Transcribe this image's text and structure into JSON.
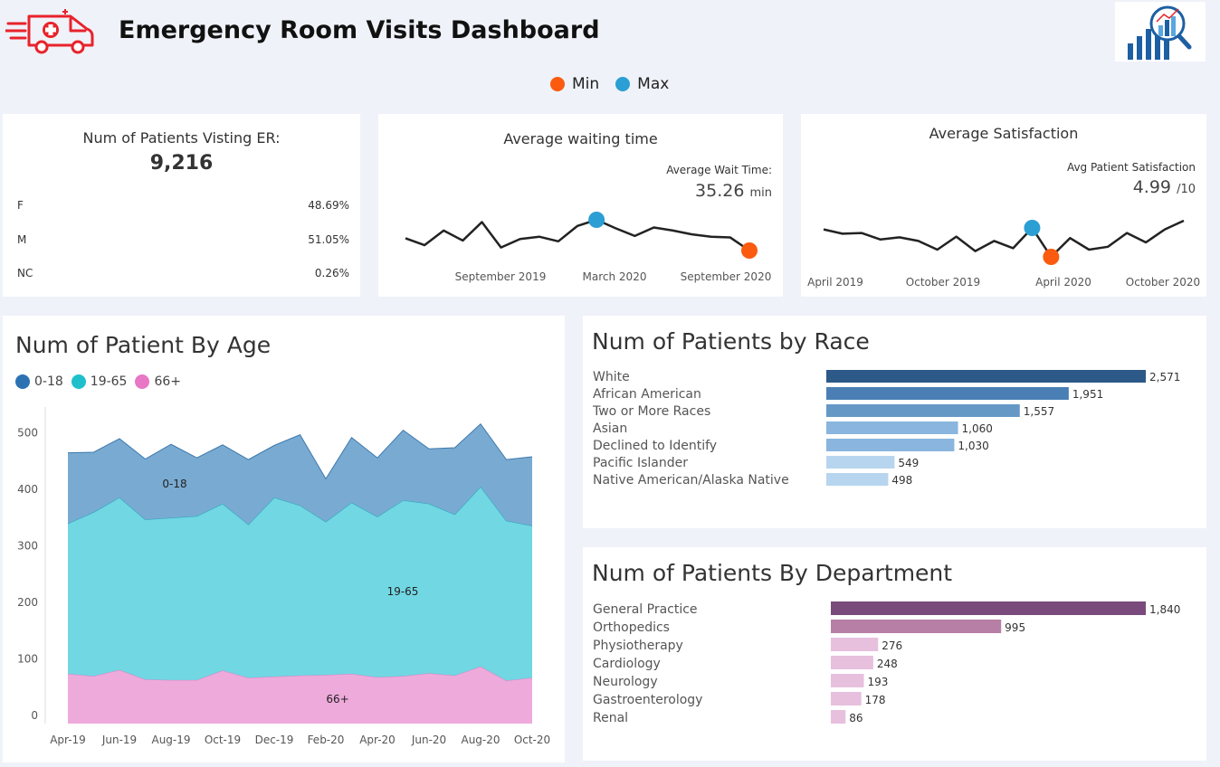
{
  "header": {
    "title": "Emergency Room Visits Dashboard"
  },
  "legend_top": {
    "min_label": "Min",
    "max_label": "Max",
    "min_color": "#fa5b0f",
    "max_color": "#2b9fd3"
  },
  "kpi_patients": {
    "title": "Num of Patients Visting ER:",
    "total": "9,216",
    "genders": [
      {
        "label": "F",
        "value": "48.69%"
      },
      {
        "label": "M",
        "value": "51.05%"
      },
      {
        "label": "NC",
        "value": "0.26%"
      }
    ]
  },
  "kpi_wait": {
    "title": "Average waiting time",
    "label": "Average Wait Time:",
    "value": "35.26",
    "unit": "min",
    "x_labels": [
      "September 2019",
      "March 2020",
      "September 2020"
    ]
  },
  "kpi_satisfaction": {
    "title": "Average Satisfaction",
    "label": "Avg Patient Satisfaction",
    "value": "4.99",
    "unit": "/10",
    "x_labels": [
      "April 2019",
      "October 2019",
      "April 2020",
      "October 2020"
    ]
  },
  "colors": {
    "age_0_18": "#2c72b3",
    "age_19_65": "#1fc0cc",
    "age_66_plus": "#e877c5",
    "race_bars": [
      "#2c5988",
      "#4a7fb5",
      "#6698c6",
      "#89b5de",
      "#89b5de",
      "#b7d5ee",
      "#b7d5ee"
    ],
    "dept_bars": [
      "#7a4a7d",
      "#b77fa6",
      "#e7c0de",
      "#e7c0de",
      "#e7c0de",
      "#e7c0de",
      "#e7c0de"
    ]
  },
  "chart_data": [
    {
      "type": "line",
      "title": "Average waiting time",
      "x": [
        "2019-05",
        "2019-06",
        "2019-07",
        "2019-08",
        "2019-09",
        "2019-10",
        "2019-11",
        "2019-12",
        "2020-01",
        "2020-02",
        "2020-03",
        "2020-04",
        "2020-05",
        "2020-06",
        "2020-07",
        "2020-08",
        "2020-09",
        "2020-10",
        "2020-11"
      ],
      "values": [
        34.8,
        33.9,
        35.8,
        34.5,
        36.9,
        33.6,
        34.7,
        35.0,
        34.4,
        36.4,
        37.2,
        36.1,
        35.1,
        36.2,
        35.8,
        35.3,
        35.0,
        34.9,
        33.2
      ],
      "min_index": 18,
      "max_index": 10,
      "x_tick_labels": [
        "September 2019",
        "March 2020",
        "September 2020"
      ]
    },
    {
      "type": "line",
      "title": "Average Satisfaction",
      "x": [
        "2019-04",
        "2019-05",
        "2019-06",
        "2019-07",
        "2019-08",
        "2019-09",
        "2019-10",
        "2019-11",
        "2019-12",
        "2020-01",
        "2020-02",
        "2020-03",
        "2020-04",
        "2020-05",
        "2020-06",
        "2020-07",
        "2020-08",
        "2020-09",
        "2020-10",
        "2020-11"
      ],
      "values": [
        5.4,
        5.1,
        5.15,
        4.7,
        4.85,
        4.6,
        4.0,
        4.9,
        3.9,
        4.6,
        4.1,
        5.5,
        3.5,
        4.8,
        4.0,
        4.2,
        5.15,
        4.5,
        5.4,
        6.0
      ],
      "min_index": 12,
      "max_index": 11,
      "x_tick_labels": [
        "April 2019",
        "October 2019",
        "April 2020",
        "October 2020"
      ]
    },
    {
      "type": "area",
      "title": "Num of Patient By Age",
      "categories": [
        "Apr-19",
        "May-19",
        "Jun-19",
        "Jul-19",
        "Aug-19",
        "Sep-19",
        "Oct-19",
        "Nov-19",
        "Dec-19",
        "Jan-20",
        "Feb-20",
        "Mar-20",
        "Apr-20",
        "May-20",
        "Jun-20",
        "Jul-20",
        "Aug-20",
        "Sep-20",
        "Oct-20"
      ],
      "x_tick_labels": [
        "Apr-19",
        "Jun-19",
        "Aug-19",
        "Oct-19",
        "Dec-19",
        "Feb-20",
        "Apr-20",
        "Jun-20",
        "Aug-20",
        "Oct-20"
      ],
      "series": [
        {
          "name": "66+",
          "values": [
            88,
            84,
            95,
            78,
            77,
            77,
            94,
            81,
            83,
            85,
            86,
            88,
            82,
            84,
            89,
            85,
            101,
            76,
            81
          ]
        },
        {
          "name": "19-65",
          "values": [
            266,
            290,
            305,
            283,
            287,
            290,
            295,
            271,
            317,
            301,
            271,
            303,
            284,
            311,
            300,
            285,
            318,
            283,
            269
          ]
        },
        {
          "name": "0-18",
          "values": [
            125,
            106,
            104,
            107,
            130,
            103,
            104,
            115,
            92,
            125,
            76,
            115,
            104,
            124,
            97,
            118,
            111,
            108,
            122
          ]
        }
      ],
      "stacked": true,
      "yticks": [
        0,
        100,
        200,
        300,
        400,
        500
      ],
      "ylim": [
        0,
        560
      ],
      "series_labels": [
        "0-18",
        "19-65",
        "66+"
      ]
    },
    {
      "type": "bar",
      "orientation": "horizontal",
      "title": "Num of Patients by Race",
      "categories": [
        "White",
        "African American",
        "Two or More Races",
        "Asian",
        "Declined to Identify",
        "Pacific Islander",
        "Native American/Alaska Native"
      ],
      "values": [
        2571,
        1951,
        1557,
        1060,
        1030,
        549,
        498
      ],
      "value_labels": [
        "2,571",
        "1,951",
        "1,557",
        "1,060",
        "1,030",
        "549",
        "498"
      ]
    },
    {
      "type": "bar",
      "orientation": "horizontal",
      "title": "Num of Patients By Department",
      "categories": [
        "General Practice",
        "Orthopedics",
        "Physiotherapy",
        "Cardiology",
        "Neurology",
        "Gastroenterology",
        "Renal"
      ],
      "values": [
        1840,
        995,
        276,
        248,
        193,
        178,
        86
      ],
      "value_labels": [
        "1,840",
        "995",
        "276",
        "248",
        "193",
        "178",
        "86"
      ]
    }
  ]
}
